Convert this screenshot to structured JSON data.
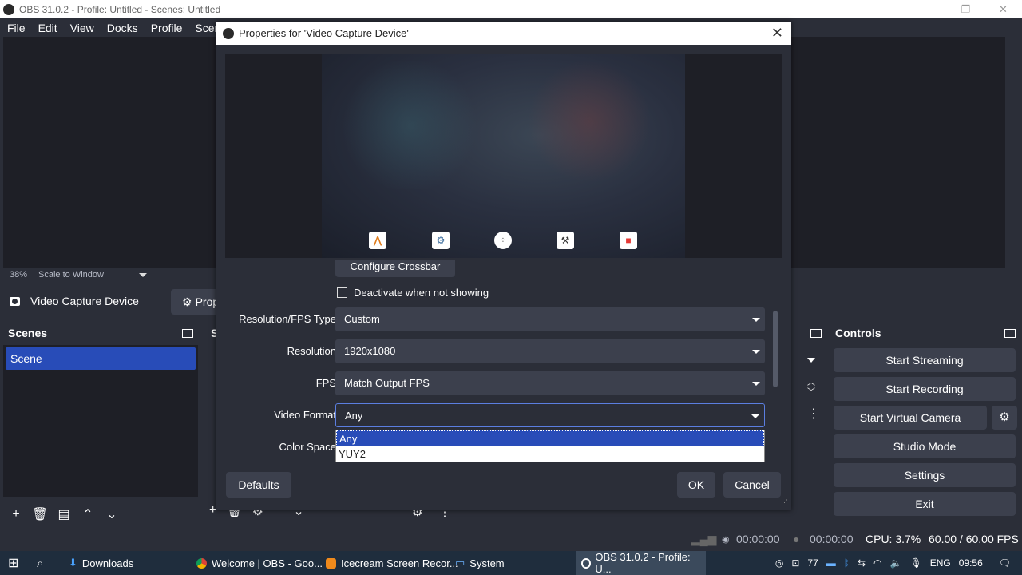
{
  "window": {
    "title": "OBS 31.0.2 - Profile: Untitled - Scenes: Untitled",
    "min": "—",
    "max": "❐",
    "close": "✕"
  },
  "menu": [
    "File",
    "Edit",
    "View",
    "Docks",
    "Profile",
    "Scene"
  ],
  "preview": {
    "zoom": "38%",
    "scale_mode": "Scale to Window"
  },
  "context": {
    "source_name": "Video Capture Device",
    "properties_label": "Prop"
  },
  "scenes_dock": {
    "title": "Scenes",
    "items": [
      "Scene"
    ]
  },
  "sources_dock": {
    "title_fragment": "S"
  },
  "controls": {
    "title": "Controls",
    "buttons": [
      "Start Streaming",
      "Start Recording",
      "Start Virtual Camera",
      "Studio Mode",
      "Settings",
      "Exit"
    ]
  },
  "statusbar": {
    "stream_time": "00:00:00",
    "record_time": "00:00:00",
    "cpu": "CPU: 3.7%",
    "fps": "60.00 / 60.00 FPS"
  },
  "dialog": {
    "title": "Properties for 'Video Capture Device'",
    "close": "✕",
    "configure_crossbar": "Configure Crossbar",
    "deactivate_label": "Deactivate when not showing",
    "fields": [
      {
        "label": "Resolution/FPS Type",
        "value": "Custom"
      },
      {
        "label": "Resolution",
        "value": "1920x1080"
      },
      {
        "label": "FPS",
        "value": "Match Output FPS"
      },
      {
        "label": "Video Format",
        "value": "Any"
      },
      {
        "label": "Color Space",
        "value": ""
      }
    ],
    "dropdown_options": [
      "Any",
      "YUY2"
    ],
    "defaults_button": "Defaults",
    "ok_button": "OK",
    "cancel_button": "Cancel"
  },
  "taskbar": {
    "apps": [
      "Downloads",
      "Welcome | OBS - Goo...",
      "Icecream Screen Recor...",
      "System",
      "OBS 31.0.2 - Profile: U..."
    ],
    "tray_number": "77",
    "lang": "ENG",
    "time": "09:56"
  },
  "colors": {
    "accent": "#284cb8",
    "panel": "#2b2e38",
    "dark": "#1e1f26",
    "button": "#3c404d"
  }
}
